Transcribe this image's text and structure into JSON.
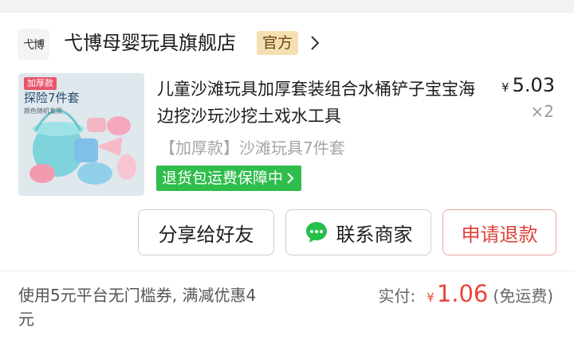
{
  "store": {
    "logo_text": "弋博",
    "name": "弋博母婴玩具旗舰店",
    "badge": "官方"
  },
  "product": {
    "thumb": {
      "tag": "加厚款",
      "headline": "探险7件套",
      "subline": "颜色随机发货"
    },
    "title": "儿童沙滩玩具加厚套装组合水桶铲子宝宝海边挖沙玩沙挖土戏水工具",
    "price_symbol": "¥",
    "price": "5.03",
    "quantity": "×2",
    "spec": "【加厚款】沙滩玩具7件套",
    "guarantee": "退货包运费保障中"
  },
  "actions": {
    "share": "分享给好友",
    "contact": "联系商家",
    "refund": "申请退款"
  },
  "summary": {
    "coupon": "使用5元平台无门槛券, 满减优惠4元",
    "paid_label": "实付:",
    "paid_symbol": "¥",
    "paid_amount": "1.06",
    "paid_note": "(免运费)"
  },
  "colors": {
    "accent_red": "#e8453c",
    "guarantee_green": "#2fbd4b",
    "official_badge_bg": "#f4dfb0",
    "chat_green": "#25c04b"
  },
  "icons": {
    "store_arrow": "chevron-right-icon",
    "guarantee_arrow": "chevron-right-icon",
    "contact": "chat-bubble-icon"
  }
}
